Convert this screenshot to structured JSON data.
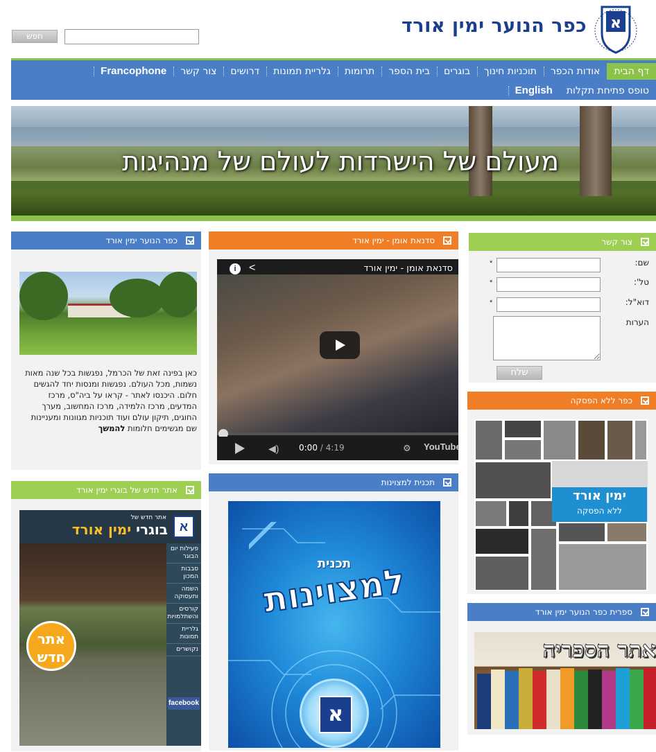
{
  "header": {
    "site_title": "כפר הנוער ימין אורד",
    "search_placeholder": "",
    "search_button": "חפש",
    "logo_icon": "school-crest-icon"
  },
  "nav": {
    "row1": [
      "דף הבית",
      "אודות הכפר",
      "תוכניות חינוך",
      "בוגרים",
      "בית הספר",
      "תרומות",
      "גלריית תמונות",
      "דרושים",
      "צור קשר",
      "Francophone"
    ],
    "row2": [
      "טופס פתיחת תקלות",
      "English"
    ],
    "active": "דף הבית",
    "colors": {
      "bar": "#4a7fc8",
      "active": "#8bc34a"
    }
  },
  "banner": {
    "text": "מעולם של הישרדות לעולם של מנהיגות"
  },
  "contact": {
    "title": "צור קשר",
    "name_label": "שם:",
    "phone_label": "טל':",
    "email_label": "דוא\"ל:",
    "notes_label": "הערות",
    "required_mark": "*",
    "send_button": "שלח"
  },
  "nostop": {
    "title": "כפר ללא הפסקה",
    "badge_line1": "ימין אורד",
    "badge_line2": "ללא הפסקה"
  },
  "library": {
    "title": "ספרית כפר הנוער ימין אורד",
    "image_text": "אתר הספריה"
  },
  "video": {
    "panel_title": "סדנאת אומן - ימין אורד",
    "video_title": "סדנאת אומן - ימין אורד",
    "current_time": "0:00",
    "duration": "/ 4:19",
    "progress": 0,
    "brand": "YouTube"
  },
  "excellence": {
    "title": "תכנית למצוינות",
    "img_small": "תכנית",
    "img_big": "למצוינות"
  },
  "village": {
    "title": "כפר הנוער ימין אורד",
    "text": "כאן בפינה זאת של הכרמל, נפגשות בכל שנה מאות נשמות, מכל העולם. נפגשות ומנסות יחד להגשים חלום. היכנסו לאתר - קראו על ביה\"ס, מרכז המדעים, מרכז הלמידה, מרכז המחשוב, מערך החוגים, תיקון עולם ועוד תוכניות מגוונות ומעניינות שם מגשימים חלומות",
    "more": "להמשך"
  },
  "alumni": {
    "title": "אתר חדש של בוגרי ימין אורד",
    "img_sub": "אתר חדש של",
    "img_title_a": "בוגרי",
    "img_title_b": "ימין אורד",
    "menu": [
      "פעילות יום הבוגר",
      "סבבות המכון",
      "השמה ותעסוקה",
      "קורסים והשתלמויות",
      "גלריית תמונות",
      "נקושרים"
    ],
    "facebook": "facebook",
    "new_badge": "אתר חדש"
  }
}
